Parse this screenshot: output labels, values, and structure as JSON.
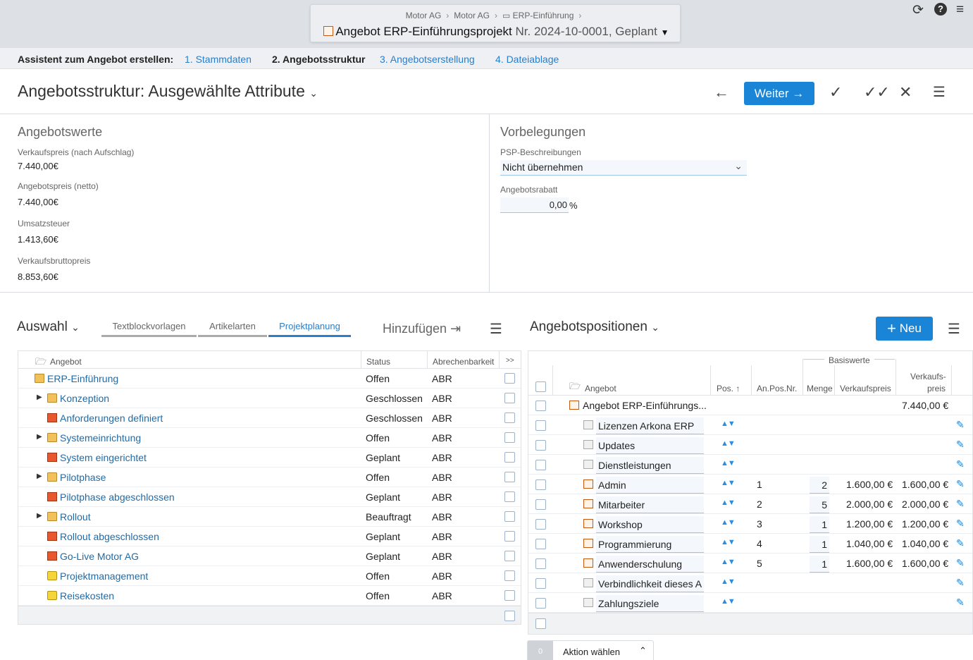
{
  "breadcrumb": [
    "Motor AG",
    "Motor AG",
    "ERP-Einführung"
  ],
  "document": {
    "title": "Angebot ERP-Einführungsprojekt",
    "number": "Nr. 2024-10-0001, Geplant"
  },
  "wizard": {
    "label": "Assistent zum Angebot erstellen:",
    "steps": [
      "1. Stammdaten",
      "2. Angebotsstruktur",
      "3. Angebotserstellung",
      "4. Dateiablage"
    ]
  },
  "header": {
    "title": "Angebotsstruktur: Ausgewählte Attribute",
    "next_label": "Weiter"
  },
  "angebotswerte": {
    "title": "Angebotswerte",
    "fields": [
      {
        "label": "Verkaufspreis (nach Aufschlag)",
        "value": "7.440,00€"
      },
      {
        "label": "Angebotspreis (netto)",
        "value": "7.440,00€"
      },
      {
        "label": "Umsatzsteuer",
        "value": "1.413,60€"
      },
      {
        "label": "Verkaufsbruttopreis",
        "value": "8.853,60€"
      }
    ]
  },
  "vorbelegungen": {
    "title": "Vorbelegungen",
    "psp_label": "PSP-Beschreibungen",
    "psp_value": "Nicht übernehmen",
    "rabatt_label": "Angebotsrabatt",
    "rabatt_value": "0,00",
    "rabatt_unit": "%"
  },
  "auswahl": {
    "title": "Auswahl",
    "tabs": [
      "Textblockvorlagen",
      "Artikelarten",
      "Projektplanung"
    ],
    "add_label": "Hinzufügen",
    "columns": [
      "Angebot",
      "Status",
      "Abrechenbarkeit",
      ">>"
    ],
    "rows": [
      {
        "name": "ERP-Einführung",
        "status": "Offen",
        "abr": "ABR"
      },
      {
        "name": "Konzeption",
        "status": "Geschlossen",
        "abr": "ABR"
      },
      {
        "name": "Anforderungen definiert",
        "status": "Geschlossen",
        "abr": "ABR"
      },
      {
        "name": "Systemeinrichtung",
        "status": "Offen",
        "abr": "ABR"
      },
      {
        "name": "System eingerichtet",
        "status": "Geplant",
        "abr": "ABR"
      },
      {
        "name": "Pilotphase",
        "status": "Offen",
        "abr": "ABR"
      },
      {
        "name": "Pilotphase abgeschlossen",
        "status": "Geplant",
        "abr": "ABR"
      },
      {
        "name": "Rollout",
        "status": "Beauftragt",
        "abr": "ABR"
      },
      {
        "name": "Rollout abgeschlossen",
        "status": "Geplant",
        "abr": "ABR"
      },
      {
        "name": "Go-Live Motor AG",
        "status": "Geplant",
        "abr": "ABR"
      },
      {
        "name": "Projektmanagement",
        "status": "Offen",
        "abr": "ABR"
      },
      {
        "name": "Reisekosten",
        "status": "Offen",
        "abr": "ABR"
      }
    ]
  },
  "positionen": {
    "title": "Angebotspositionen",
    "new_label": "Neu",
    "group_label": "Basiswerte",
    "columns": [
      "Angebot",
      "Pos.",
      "An.Pos.Nr.",
      "Menge",
      "Verkaufspreis",
      "Verkaufs-",
      "preis"
    ],
    "root": {
      "name": "Angebot ERP-Einführungs...",
      "total": "7.440,00 €"
    },
    "rows": [
      {
        "name": "Lizenzen Arkona ERP",
        "pos": "",
        "qty": "",
        "price": "",
        "total": ""
      },
      {
        "name": "Updates",
        "pos": "",
        "qty": "",
        "price": "",
        "total": ""
      },
      {
        "name": "Dienstleistungen",
        "pos": "",
        "qty": "",
        "price": "",
        "total": ""
      },
      {
        "name": "Admin",
        "pos": "1",
        "qty": "2",
        "price": "1.600,00 €",
        "total": "1.600,00 €"
      },
      {
        "name": "Mitarbeiter",
        "pos": "2",
        "qty": "5",
        "price": "2.000,00 €",
        "total": "2.000,00 €"
      },
      {
        "name": "Workshop",
        "pos": "3",
        "qty": "1",
        "price": "1.200,00 €",
        "total": "1.200,00 €"
      },
      {
        "name": "Programmierung",
        "pos": "4",
        "qty": "1",
        "price": "1.040,00 €",
        "total": "1.040,00 €"
      },
      {
        "name": "Anwenderschulung",
        "pos": "5",
        "qty": "1",
        "price": "1.600,00 €",
        "total": "1.600,00 €"
      },
      {
        "name": "Verbindlichkeit dieses A",
        "pos": "",
        "qty": "",
        "price": "",
        "total": ""
      },
      {
        "name": "Zahlungsziele",
        "pos": "",
        "qty": "",
        "price": "",
        "total": ""
      }
    ]
  },
  "aktion": {
    "count": "0",
    "label": "Aktion wählen"
  }
}
